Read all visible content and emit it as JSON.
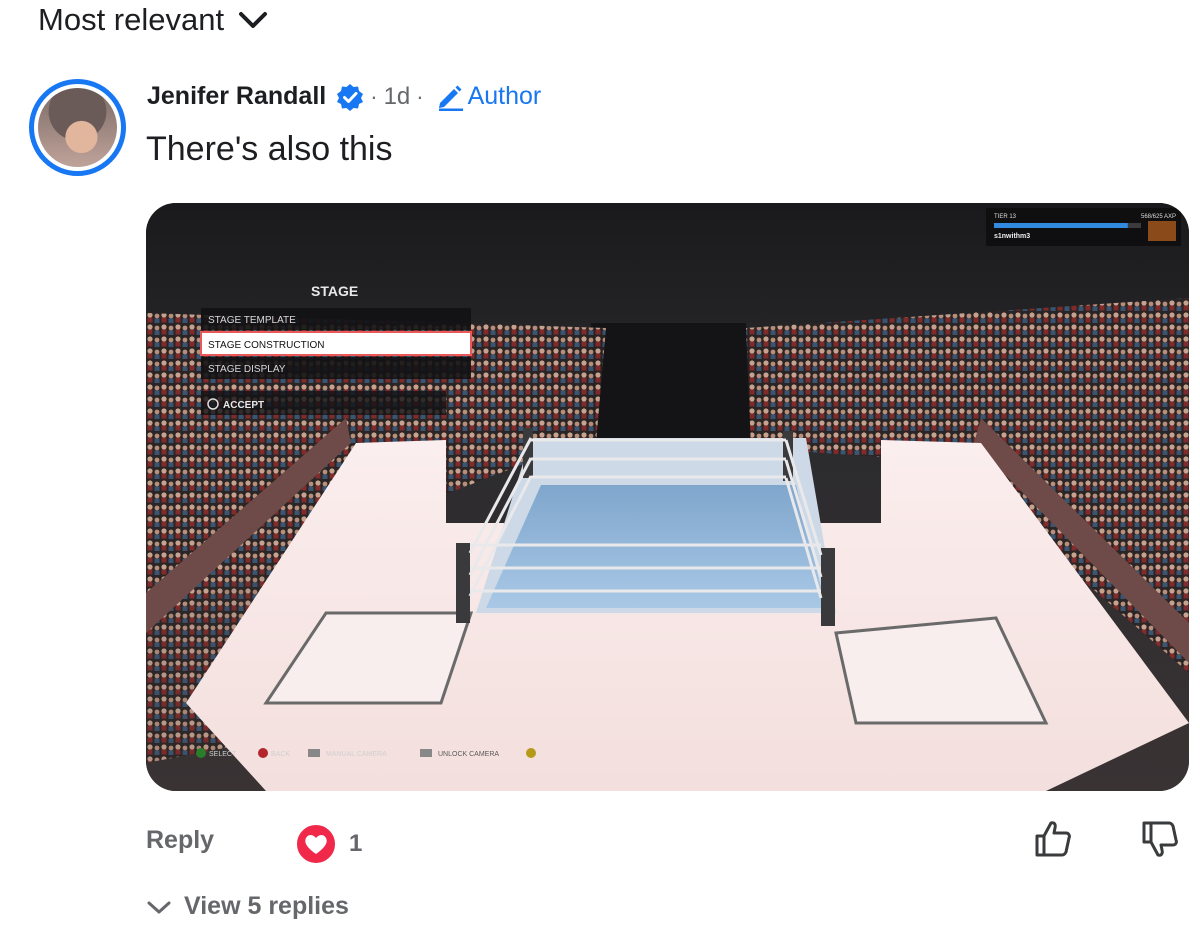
{
  "sort": {
    "label": "Most relevant",
    "icon": "chevron-down-icon"
  },
  "comment": {
    "author": "Jenifer Randall",
    "verified": true,
    "separator": "·",
    "time": "1d",
    "badge_icon": "pencil-icon",
    "badge_label": "Author",
    "text": "There's also this",
    "accent_color": "#1877f2"
  },
  "media": {
    "menu_title": "STAGE",
    "menu_items": [
      "STAGE TEMPLATE",
      "STAGE CONSTRUCTION",
      "STAGE DISPLAY"
    ],
    "selected_item": "STAGE CONSTRUCTION",
    "accept_label": "ACCEPT",
    "tier_label": "TIER 13",
    "xp_label": "568/625 AXP",
    "xp_progress": 0.91,
    "username": "s1nwithm3",
    "controls": [
      "SELECT",
      "BACK",
      "MANUAL CAMERA",
      "UNLOCK CAMERA"
    ]
  },
  "actions": {
    "reply_label": "Reply",
    "reaction_icon": "heart-icon",
    "reaction_color": "#f02849",
    "reaction_count": "1",
    "like_icon": "thumbs-up-icon",
    "dislike_icon": "thumbs-down-icon",
    "view_replies_label": "View 5 replies"
  }
}
